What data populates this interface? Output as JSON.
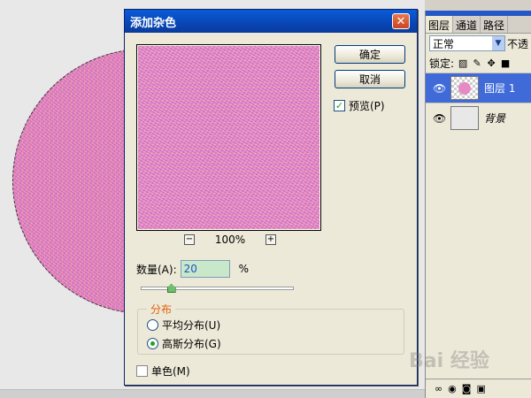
{
  "dialog": {
    "title": "添加杂色",
    "close_glyph": "✕",
    "ok_label": "确定",
    "cancel_label": "取消",
    "preview_label": "预览(P)",
    "preview_checked": true,
    "zoom_minus": "−",
    "zoom_plus": "+",
    "zoom_level": "100%",
    "amount_label": "数量(A):",
    "amount_value": "20",
    "amount_unit": "%",
    "slider_level_percent": 20,
    "distribution": {
      "legend": "分布",
      "uniform_label": "平均分布(U)",
      "gaussian_label": "高斯分布(G)",
      "selected": "gaussian"
    },
    "monochrome_label": "单色(M)",
    "monochrome_checked": false
  },
  "layers_panel": {
    "tabs": [
      "图层",
      "通道",
      "路径"
    ],
    "blend_mode": "正常",
    "opacity_label_partial": "不透",
    "lock_label": "锁定:",
    "layers": [
      {
        "name": "图层 1",
        "selected": true,
        "visible": true
      },
      {
        "name": "背景",
        "selected": false,
        "visible": true
      }
    ]
  },
  "watermark": "Bai 经验",
  "colors": {
    "titlebar": "#0a5bd8",
    "dialog_bg": "#ece9d8",
    "noise_pink": "#e07ab8",
    "selected_layer": "#3f6ad8",
    "legend_orange": "#e0610d"
  }
}
